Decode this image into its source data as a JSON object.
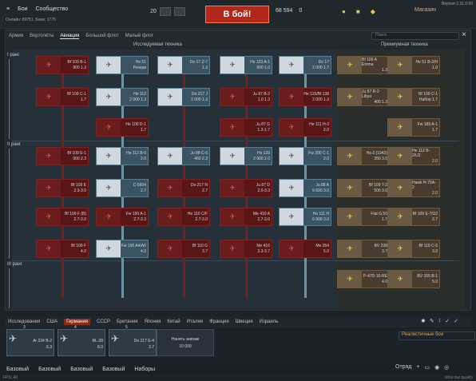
{
  "topbar": {
    "menu": "≡",
    "battles": "Бои",
    "community": "Сообщество",
    "online": "Онлайн: 89751, Боев: 1775",
    "rank": "20",
    "battle_btn": "В бой!",
    "silver": "68 594",
    "gold": "0",
    "shop": "Магазин",
    "version": "Версия 2.31.0.50"
  },
  "tabs": [
    "Армия",
    "Вертолёты",
    "Авиация",
    "Большой флот",
    "Малый флот"
  ],
  "search_placeholder": "Поиск",
  "headers": {
    "researched": "Исследуемая техника",
    "premium": "Премиумная техника"
  },
  "ranks": [
    "I ранг",
    "II ранг",
    "III ранг"
  ],
  "cards": [
    {
      "n": "Bf 109 B-1",
      "b": "900 1.3",
      "c": "red"
    },
    {
      "n": "He 51",
      "b": "Резерв",
      "c": "blue"
    },
    {
      "n": "Do 17 Z-7",
      "b": "1.3",
      "c": "blue"
    },
    {
      "n": "Hs 123 A-1",
      "b": "900 1.0",
      "c": "blue"
    },
    {
      "n": "Do 17",
      "b": "2 000 1.7",
      "c": "blue"
    },
    {
      "n": "Bf 109 C-1",
      "b": "1.7",
      "c": "red"
    },
    {
      "n": "He 112",
      "b": "2 900 1.3",
      "c": "blue"
    },
    {
      "n": "Do 217 J",
      "b": "2 000 1.3",
      "c": "blue"
    },
    {
      "n": "Ju 87 B-2",
      "b": "1.0 1.3",
      "c": "red"
    },
    {
      "n": "He 115/Bf 138",
      "b": "2 000 1.3",
      "c": "red"
    },
    {
      "n": "He 100 D-1",
      "b": "1.7",
      "c": "red"
    },
    {
      "n": "Ju 87 G",
      "b": "1.3-1.7",
      "c": "red"
    },
    {
      "n": "He 111 H-3",
      "b": "2.0",
      "c": "red"
    },
    {
      "n": "Bf 109 E-1",
      "b": "900 2.3",
      "c": "red"
    },
    {
      "n": "He 112 B-0",
      "b": "2.0",
      "c": "blue"
    },
    {
      "n": "Ju 88 C-6",
      "b": "460 2.3",
      "c": "blue"
    },
    {
      "n": "Hs 129",
      "b": "2 900 2.0",
      "c": "blue"
    },
    {
      "n": "Fw 200 C-1",
      "b": "2.0",
      "c": "blue"
    },
    {
      "n": "Bf 109 E",
      "b": "2.3-3.0",
      "c": "red"
    },
    {
      "n": "C-5604",
      "b": "2.7",
      "c": "blue"
    },
    {
      "n": "Do 217 N",
      "b": "2.7",
      "c": "red"
    },
    {
      "n": "Ju 87 D",
      "b": "2.0-3.3",
      "c": "red"
    },
    {
      "n": "Ju 88 A",
      "b": "5 600 3.0",
      "c": "blue"
    },
    {
      "n": "Bf 109 F (B)",
      "b": "2.7-3.0",
      "c": "red"
    },
    {
      "n": "Fw 190 A-1",
      "b": "2.7-3.3",
      "c": "red"
    },
    {
      "n": "He 110 C/F",
      "b": "2.7-3.0",
      "c": "red"
    },
    {
      "n": "Me 410 A",
      "b": "2.7-3.0",
      "c": "red"
    },
    {
      "n": "He 111 H",
      "b": "6 900 3.0",
      "c": "blue"
    },
    {
      "n": "Bf 109 F",
      "b": "4.0",
      "c": "red"
    },
    {
      "n": "Fw 190 A4/A5",
      "b": "4.0",
      "c": "blue"
    },
    {
      "n": "Bf 110 G",
      "b": "3.7",
      "c": "red"
    },
    {
      "n": "Me 410",
      "b": "3.3-3.7",
      "c": "red"
    },
    {
      "n": "Me 264",
      "b": "5.0",
      "c": "red"
    }
  ],
  "premium": [
    {
      "n": "Bf 109 A Emma",
      "b": "1.3"
    },
    {
      "n": "He 51 B-2/H",
      "b": "1.0"
    },
    {
      "n": "Ju 87 R-2 Libya",
      "b": "400 1.3"
    },
    {
      "n": "Bf 109 C-1",
      "b": "Набор 1.7"
    },
    {
      "n": "Fw 189 A-1",
      "b": "1.7"
    },
    {
      "n": "Hs-2 (1942)",
      "b": "350 3.0"
    },
    {
      "n": "He 112 B-2/U2",
      "b": "2.0"
    },
    {
      "n": "Bf 109 T-2",
      "b": "500 3.0"
    },
    {
      "n": "Hawk H-75A-2",
      "b": "2.0"
    },
    {
      "n": "Fiat G.50",
      "b": "1.7"
    },
    {
      "n": "Bf 109 E-7/U2",
      "b": "2.7"
    },
    {
      "n": "BV 238",
      "b": "3.7"
    },
    {
      "n": "Bf 110 C-6",
      "b": "3.0"
    },
    {
      "n": "P-47D-16-RE",
      "b": "4.0"
    },
    {
      "n": "BV 155 B-1",
      "b": "5.0"
    }
  ],
  "mode": "Реалистичные бои",
  "nations": [
    "Исследования",
    "США",
    "Германия",
    "СССР",
    "Британия",
    "Япония",
    "Китай",
    "Италия",
    "Франция",
    "Швеция",
    "Израиль"
  ],
  "crew": [
    {
      "num": "3",
      "n": "Ar 234 B-2",
      "b": "6.3"
    },
    {
      "num": "4",
      "n": "ФL-28",
      "b": "8.0"
    },
    {
      "num": "5",
      "n": "Do 217 E-4",
      "b": "3.7"
    }
  ],
  "buy": {
    "label": "Нанять экипаж",
    "cost": "10 000"
  },
  "bottom": [
    "Базовый",
    "Базовый",
    "Базовый",
    "Базовый",
    "Наборы"
  ],
  "squad": "Отряд",
  "status_left": "FPS: 40",
  "status_right": "Ultra low quality"
}
